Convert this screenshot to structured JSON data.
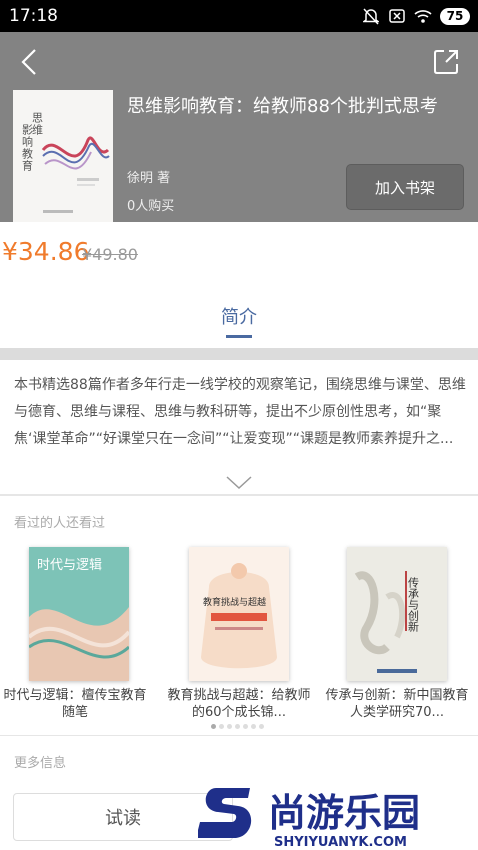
{
  "status": {
    "time": "17:18",
    "battery": "75"
  },
  "book": {
    "title": "思维影响教育：给教师88个批判式思考",
    "author": "徐明 著",
    "buyers": "0人购买",
    "add_shelf_label": "加入书架",
    "cover_title": "思维影响教育",
    "cover_subtitle": "给教师88个批判式思考"
  },
  "price": {
    "current": "¥34.86",
    "original": "¥49.80"
  },
  "tabs": {
    "intro": "简介"
  },
  "intro_text": "本书精选88篇作者多年行走一线学校的观察笔记，围绕思维与课堂、思维与德育、思维与课程、思维与教科研等，提出不少原创性思考，如“聚焦‘课堂革命”“好课堂只在一念间”“让爱变现”“课题是教师素养提升之...",
  "also_viewed": {
    "title": "看过的人还看过",
    "books": [
      {
        "name": "时代与逻辑：檀传宝教育随笔",
        "cover_text": "时代与逻辑",
        "cover_color": "#7dc3b7"
      },
      {
        "name": "教育挑战与超越：给教师的60个成长锦...",
        "cover_text": "教育挑战与超越",
        "cover_color": "#f6dcc8"
      },
      {
        "name": "传承与创新：新中国教育人类学研究70...",
        "cover_text": "传承与创新",
        "cover_color": "#ecebe4"
      }
    ]
  },
  "more_info": {
    "title": "更多信息"
  },
  "actions": {
    "trial_label": "试读"
  },
  "watermark": {
    "brand": "尚游乐园",
    "url": "SHYIYUANYK.COM"
  },
  "colors": {
    "accent": "#4a6aa1",
    "price": "#f07b2c",
    "header_bg": "#838383"
  }
}
